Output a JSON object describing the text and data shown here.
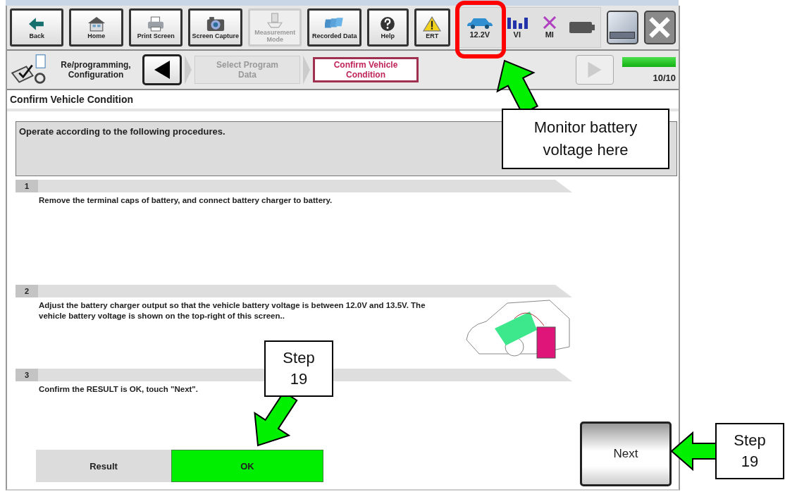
{
  "toolbar": {
    "buttons": [
      {
        "kind": "back",
        "label": "Back",
        "disabled": false
      },
      {
        "kind": "home",
        "label": "Home",
        "disabled": false
      },
      {
        "kind": "print",
        "label": "Print Screen",
        "disabled": false
      },
      {
        "kind": "camera",
        "label": "Screen Capture",
        "disabled": false
      },
      {
        "kind": "measure",
        "label": "Measurement Mode",
        "disabled": true
      },
      {
        "kind": "recorded",
        "label": "Recorded Data",
        "disabled": false
      },
      {
        "kind": "help",
        "label": "Help",
        "disabled": false
      },
      {
        "kind": "warning",
        "label": "ERT",
        "disabled": false
      }
    ],
    "status": [
      {
        "kind": "voltage",
        "label": "12.2V"
      },
      {
        "kind": "signal",
        "label": "VI"
      },
      {
        "kind": "cross",
        "label": "MI"
      },
      {
        "kind": "battery"
      }
    ]
  },
  "navigation": {
    "section": "Re/programming, Configuration",
    "steps": [
      {
        "label": "Select Program Data",
        "selected": false
      },
      {
        "label": "Confirm Vehicle Condition",
        "selected": true
      }
    ],
    "next_disabled": true,
    "progress": {
      "level": 1,
      "reading": "10/10"
    }
  },
  "page_title": "Confirm Vehicle Condition",
  "instruction": "Operate according to the following procedures.",
  "steps": [
    {
      "number": "1",
      "text": "Remove the terminal caps of battery, and connect battery charger to battery.",
      "illustration": false
    },
    {
      "number": "2",
      "text": "Adjust the battery charger output so that the vehicle battery voltage is between 12.0V and 13.5V. The vehicle battery voltage is shown on the top-right of this screen..",
      "illustration": true
    },
    {
      "number": "3",
      "text": "Confirm the RESULT is OK, touch \"Next\".",
      "illustration": false
    }
  ],
  "result": {
    "label": "Result",
    "value": "OK"
  },
  "next_button": "Next",
  "annotations": [
    {
      "kind": "callout",
      "text": "Monitor battery voltage here"
    },
    {
      "kind": "step",
      "text": "Step 19"
    },
    {
      "kind": "step",
      "text": "Step 19"
    }
  ]
}
